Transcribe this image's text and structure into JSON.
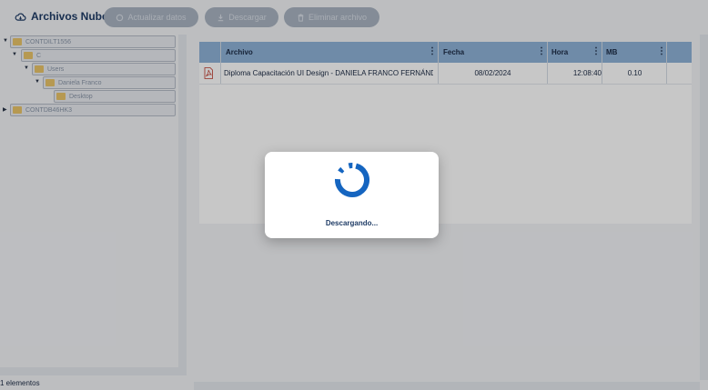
{
  "app": {
    "title": "Archivos Nube"
  },
  "toolbar": {
    "refresh_label": "Actualizar datos",
    "download_label": "Descargar",
    "delete_label": "Eliminar archivo"
  },
  "tree": {
    "nodes": [
      {
        "label": "CONTDILT1556",
        "expanded": true
      },
      {
        "label": "C",
        "expanded": true
      },
      {
        "label": "Users",
        "expanded": true
      },
      {
        "label": "Daniela Franco",
        "expanded": true
      },
      {
        "label": "Desktop",
        "expanded": false
      },
      {
        "label": "CONTDB46HK3",
        "expanded": false
      }
    ]
  },
  "grid": {
    "columns": [
      "Archivo",
      "Fecha",
      "Hora",
      "MB"
    ],
    "rows": [
      {
        "archivo": "Diploma Capacitación UI Design - DANIELA FRANCO FERNÁNDEZ.pdf",
        "fecha": "08/02/2024",
        "hora": "12:08:40",
        "mb": "0.10"
      }
    ]
  },
  "status": {
    "count_text": "1 elementos"
  },
  "modal": {
    "message": "Descargando..."
  },
  "colors": {
    "header": "#8fb3d8",
    "accent": "#1565c0",
    "folder": "#e9c46a"
  }
}
